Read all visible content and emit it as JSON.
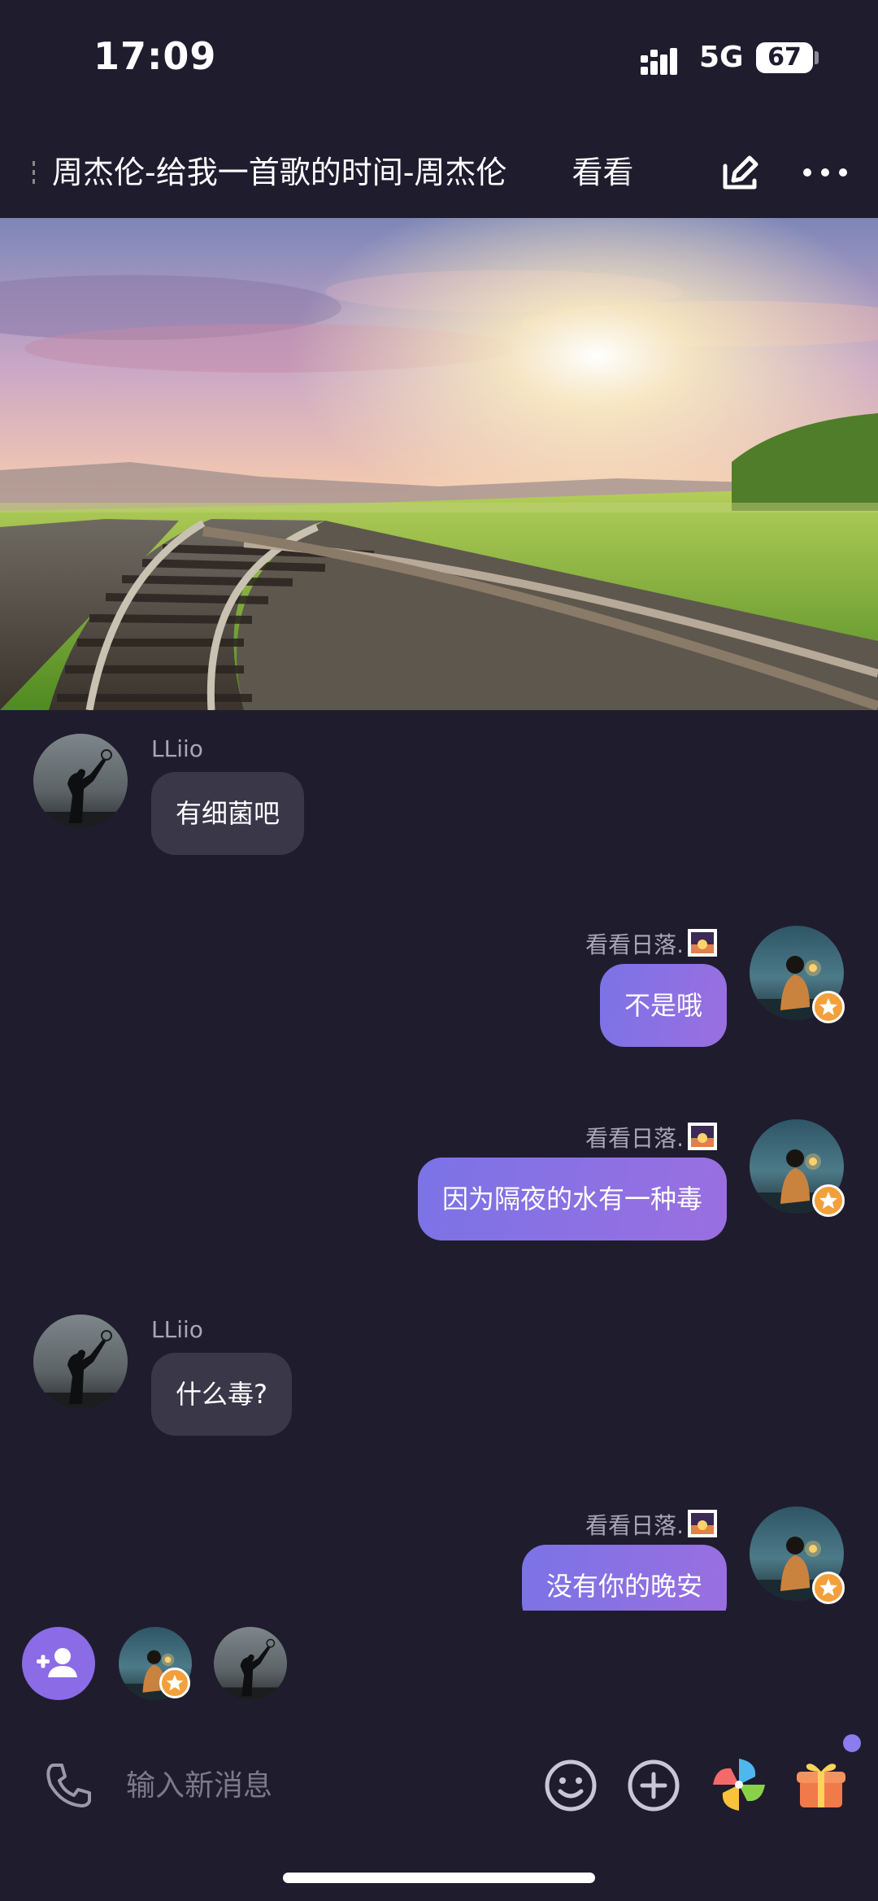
{
  "status_bar": {
    "time": "17:09",
    "network": "5G",
    "battery": "67"
  },
  "header": {
    "song_title": "周杰伦-给我一首歌的时间-周杰伦",
    "song_next": "看看",
    "icons": {
      "edit": "edit-icon",
      "more": "more-icon"
    }
  },
  "chat": {
    "messages": [
      {
        "sender": "LLiio",
        "text": "有细菌吧",
        "direction": "incoming"
      },
      {
        "sender": "看看日落.",
        "text": "不是哦",
        "direction": "outgoing"
      },
      {
        "sender": "看看日落.",
        "text": "因为隔夜的水有一种毒",
        "direction": "outgoing"
      },
      {
        "sender": "LLiio",
        "text": "什么毒?",
        "direction": "incoming"
      },
      {
        "sender": "看看日落.",
        "text": "没有你的晚安",
        "direction": "outgoing"
      }
    ]
  },
  "member_strip": {
    "icons": {
      "add_member": "add-person-icon"
    }
  },
  "input_bar": {
    "placeholder": "输入新消息",
    "icons": {
      "phone": "phone-icon",
      "emoji": "emoji-icon",
      "plus": "plus-circle-icon",
      "pinwheel": "pinwheel-icon",
      "gift": "gift-icon"
    }
  },
  "colors": {
    "background": "#1f1c2e",
    "incoming_bubble": "#3a3749",
    "outgoing_bubble_start": "#7b73e6",
    "outgoing_bubble_end": "#9a6fe0",
    "accent": "#8b6be6"
  }
}
